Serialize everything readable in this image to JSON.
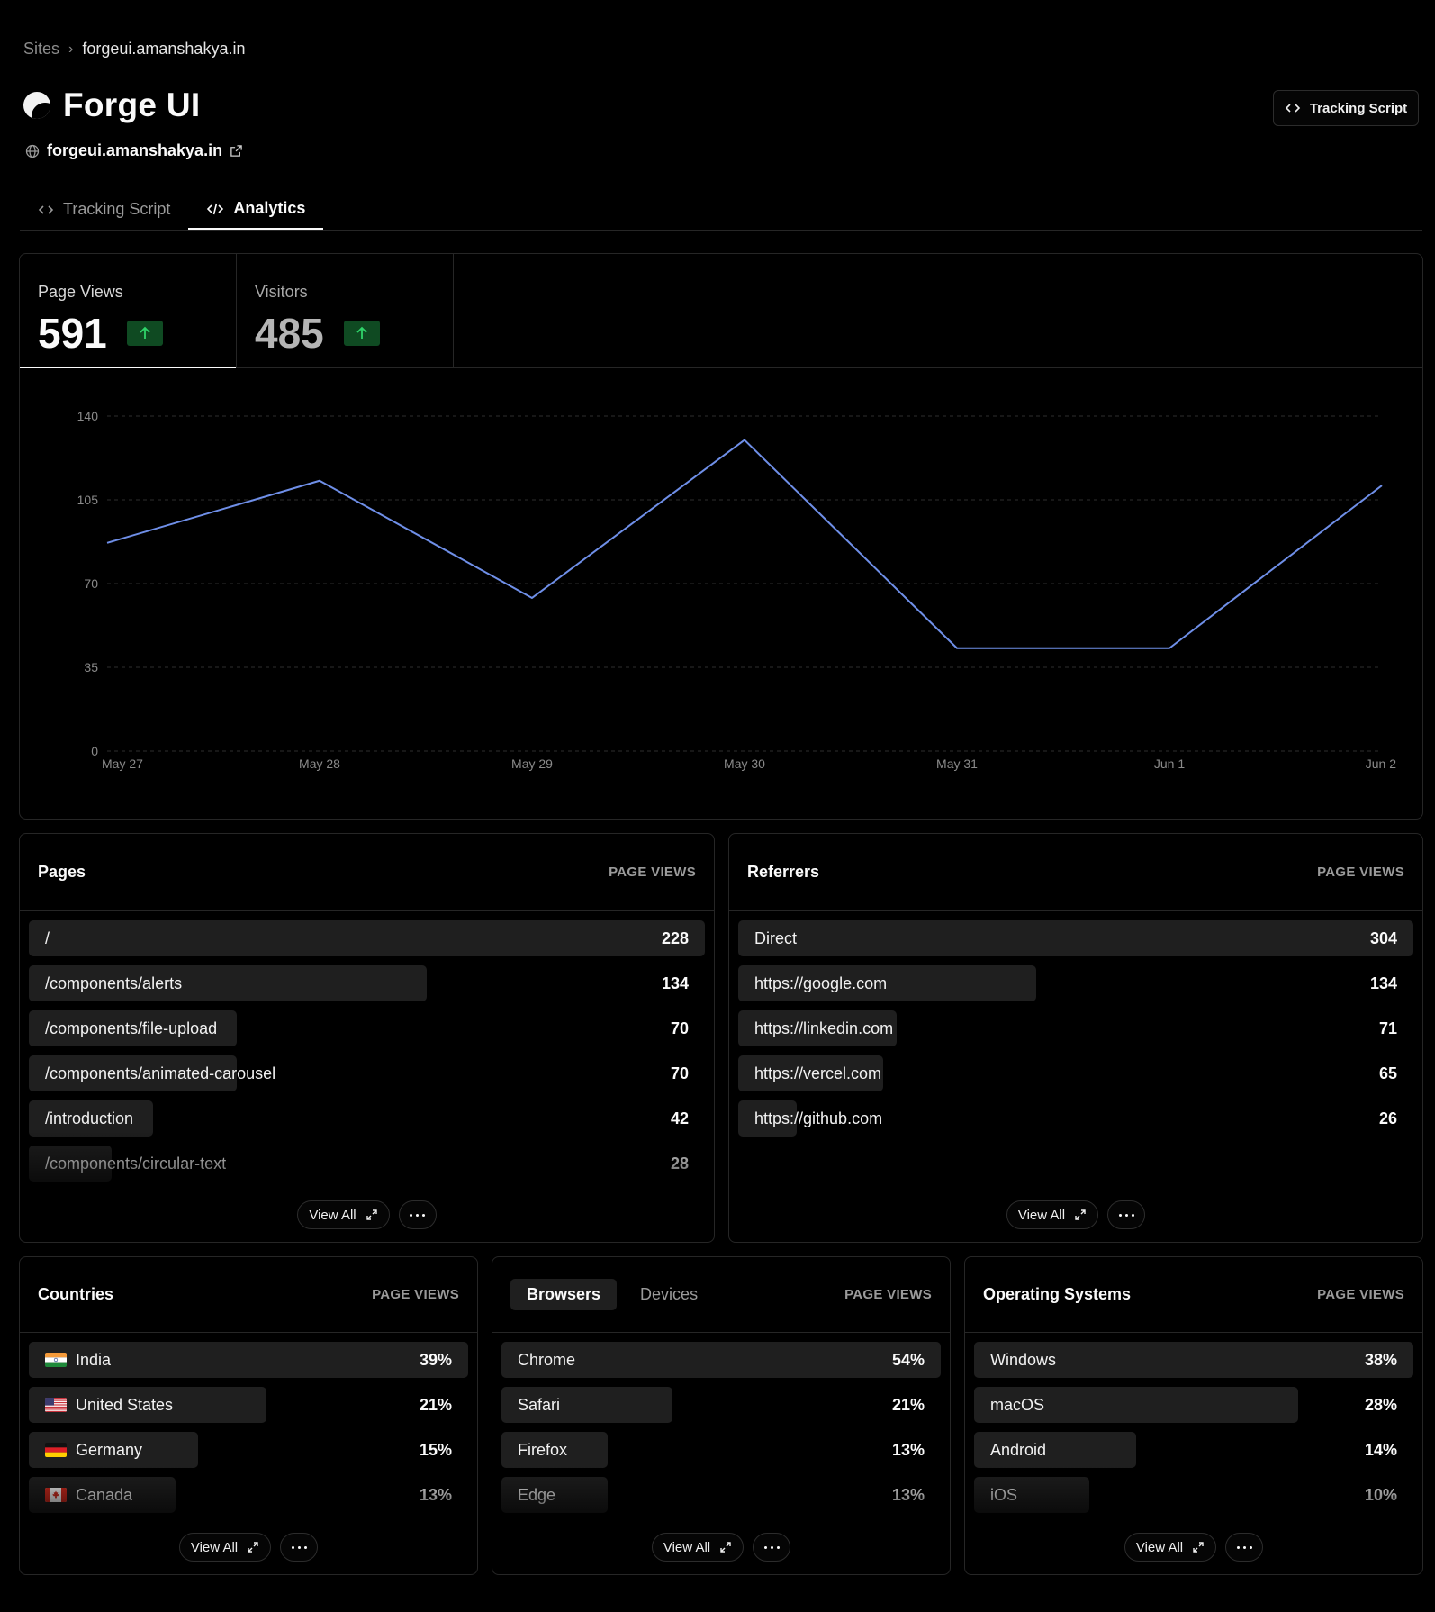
{
  "breadcrumb": {
    "root": "Sites",
    "current": "forgeui.amanshakya.in"
  },
  "site": {
    "title": "Forge UI",
    "domain": "forgeui.amanshakya.in"
  },
  "header_button": "Tracking Script",
  "tabs": [
    {
      "label": "Tracking Script"
    },
    {
      "label": "Analytics"
    }
  ],
  "stats": [
    {
      "label": "Page Views",
      "value": "591",
      "trend": "up"
    },
    {
      "label": "Visitors",
      "value": "485",
      "trend": "up"
    }
  ],
  "chart_data": {
    "type": "line",
    "categories": [
      "May 27",
      "May 28",
      "May 29",
      "May 30",
      "May 31",
      "Jun 1",
      "Jun 2"
    ],
    "series": [
      {
        "values": [
          87,
          113,
          64,
          130,
          43,
          43,
          111
        ]
      }
    ],
    "ylim": [
      0,
      140
    ],
    "yticks": [
      0,
      35,
      70,
      105,
      140
    ],
    "color": "#6f8fe8",
    "grid": "dashed horizontal"
  },
  "pages": {
    "title": "Pages",
    "column": "PAGE VIEWS",
    "rows": [
      {
        "label": "/",
        "value": "228",
        "share": 1.0
      },
      {
        "label": "/components/alerts",
        "value": "134",
        "share": 0.588
      },
      {
        "label": "/components/file-upload",
        "value": "70",
        "share": 0.307
      },
      {
        "label": "/components/animated-carousel",
        "value": "70",
        "share": 0.307
      },
      {
        "label": "/introduction",
        "value": "42",
        "share": 0.184
      },
      {
        "label": "/components/circular-text",
        "value": "28",
        "share": 0.123
      }
    ]
  },
  "referrers": {
    "title": "Referrers",
    "column": "PAGE VIEWS",
    "rows": [
      {
        "label": "Direct",
        "value": "304",
        "share": 1.0
      },
      {
        "label": "https://google.com",
        "value": "134",
        "share": 0.441
      },
      {
        "label": "https://linkedin.com",
        "value": "71",
        "share": 0.234
      },
      {
        "label": "https://vercel.com",
        "value": "65",
        "share": 0.214
      },
      {
        "label": "https://github.com",
        "value": "26",
        "share": 0.086
      }
    ]
  },
  "countries": {
    "title": "Countries",
    "column": "PAGE VIEWS",
    "rows": [
      {
        "label": "India",
        "value": "39%",
        "share": 1.0,
        "flag": "in"
      },
      {
        "label": "United States",
        "value": "21%",
        "share": 0.54,
        "flag": "us"
      },
      {
        "label": "Germany",
        "value": "15%",
        "share": 0.385,
        "flag": "de"
      },
      {
        "label": "Canada",
        "value": "13%",
        "share": 0.333,
        "flag": "ca"
      }
    ]
  },
  "browsers": {
    "tabs": [
      "Browsers",
      "Devices"
    ],
    "column": "PAGE VIEWS",
    "rows": [
      {
        "label": "Chrome",
        "value": "54%",
        "share": 1.0
      },
      {
        "label": "Safari",
        "value": "21%",
        "share": 0.389
      },
      {
        "label": "Firefox",
        "value": "13%",
        "share": 0.241
      },
      {
        "label": "Edge",
        "value": "13%",
        "share": 0.241
      }
    ]
  },
  "os": {
    "title": "Operating Systems",
    "column": "PAGE VIEWS",
    "rows": [
      {
        "label": "Windows",
        "value": "38%",
        "share": 1.0
      },
      {
        "label": "macOS",
        "value": "28%",
        "share": 0.737
      },
      {
        "label": "Android",
        "value": "14%",
        "share": 0.368
      },
      {
        "label": "iOS",
        "value": "10%",
        "share": 0.263
      }
    ]
  },
  "footer": {
    "view_all": "View All"
  }
}
